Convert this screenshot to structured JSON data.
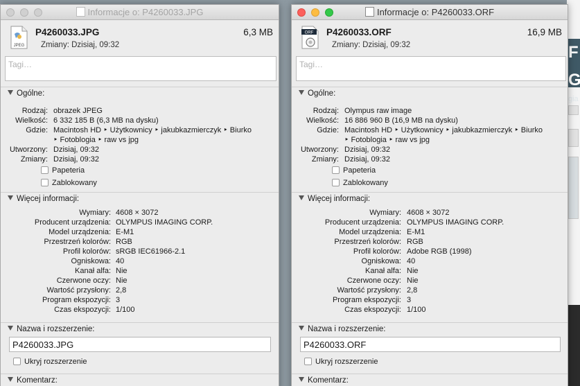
{
  "background_window": {
    "big_text": "F G",
    "small_text": "gia"
  },
  "windows": [
    {
      "id": "left",
      "title": "Informacje o: P4260033.JPG",
      "file_name": "P4260033.JPG",
      "file_size": "6,3 MB",
      "modified": "Zmiany: Dzisiaj, 09:32",
      "icon": "jpeg-file-icon",
      "icon_label": "JPEG",
      "tags_placeholder": "Tagi…",
      "general": {
        "header": "Ogólne:",
        "rows": [
          {
            "label": "Rodzaj:",
            "value": "obrazek JPEG"
          },
          {
            "label": "Wielkość:",
            "value": "6 332 185 B (6,3 MB na dysku)"
          },
          {
            "label": "Gdzie:",
            "value": "Macintosh HD ‣ Użytkownicy ‣ jakubkazmierczyk ‣ Biurko"
          },
          {
            "label": "",
            "value": "‣ Fotoblogia ‣ raw vs jpg"
          },
          {
            "label": "Utworzony:",
            "value": "Dzisiaj, 09:32"
          },
          {
            "label": "Zmiany:",
            "value": "Dzisiaj, 09:32"
          }
        ],
        "stationery": "Papeteria",
        "locked": "Zablokowany"
      },
      "more_info": {
        "header": "Więcej informacji:",
        "rows": [
          {
            "label": "Wymiary:",
            "value": "4608 × 3072"
          },
          {
            "label": "Producent urządzenia:",
            "value": "OLYMPUS IMAGING CORP."
          },
          {
            "label": "Model urządzenia:",
            "value": "E-M1"
          },
          {
            "label": "Przestrzeń kolorów:",
            "value": "RGB"
          },
          {
            "label": "Profil kolorów:",
            "value": "sRGB IEC61966-2.1"
          },
          {
            "label": "Ogniskowa:",
            "value": "40"
          },
          {
            "label": "Kanał alfa:",
            "value": "Nie"
          },
          {
            "label": "Czerwone oczy:",
            "value": "Nie"
          },
          {
            "label": "Wartość przysłony:",
            "value": "2,8"
          },
          {
            "label": "Program ekspozycji:",
            "value": "3"
          },
          {
            "label": "Czas ekspozycji:",
            "value": "1/100"
          }
        ]
      },
      "name_ext": {
        "header": "Nazwa i rozszerzenie:",
        "value": "P4260033.JPG",
        "hide_ext": "Ukryj rozszerzenie"
      },
      "comments": {
        "header": "Komentarz:"
      }
    },
    {
      "id": "right",
      "title": "Informacje o: P4260033.ORF",
      "file_name": "P4260033.ORF",
      "file_size": "16,9 MB",
      "modified": "Zmiany: Dzisiaj, 09:32",
      "icon": "orf-file-icon",
      "icon_label": "ORF",
      "tags_placeholder": "Tagi…",
      "general": {
        "header": "Ogólne:",
        "rows": [
          {
            "label": "Rodzaj:",
            "value": "Olympus raw image"
          },
          {
            "label": "Wielkość:",
            "value": "16 886 960 B (16,9 MB na dysku)"
          },
          {
            "label": "Gdzie:",
            "value": "Macintosh HD ‣ Użytkownicy ‣ jakubkazmierczyk ‣ Biurko"
          },
          {
            "label": "",
            "value": "‣ Fotoblogia ‣ raw vs jpg"
          },
          {
            "label": "Utworzony:",
            "value": "Dzisiaj, 09:32"
          },
          {
            "label": "Zmiany:",
            "value": "Dzisiaj, 09:32"
          }
        ],
        "stationery": "Papeteria",
        "locked": "Zablokowany"
      },
      "more_info": {
        "header": "Więcej informacji:",
        "rows": [
          {
            "label": "Wymiary:",
            "value": "4608 × 3072"
          },
          {
            "label": "Producent urządzenia:",
            "value": "OLYMPUS IMAGING CORP."
          },
          {
            "label": "Model urządzenia:",
            "value": "E-M1"
          },
          {
            "label": "Przestrzeń kolorów:",
            "value": "RGB"
          },
          {
            "label": "Profil kolorów:",
            "value": "Adobe RGB (1998)"
          },
          {
            "label": "Ogniskowa:",
            "value": "40"
          },
          {
            "label": "Kanał alfa:",
            "value": "Nie"
          },
          {
            "label": "Czerwone oczy:",
            "value": "Nie"
          },
          {
            "label": "Wartość przysłony:",
            "value": "2,8"
          },
          {
            "label": "Program ekspozycji:",
            "value": "3"
          },
          {
            "label": "Czas ekspozycji:",
            "value": "1/100"
          }
        ]
      },
      "name_ext": {
        "header": "Nazwa i rozszerzenie:",
        "value": "P4260033.ORF",
        "hide_ext": "Ukryj rozszerzenie"
      },
      "comments": {
        "header": "Komentarz:"
      }
    }
  ]
}
